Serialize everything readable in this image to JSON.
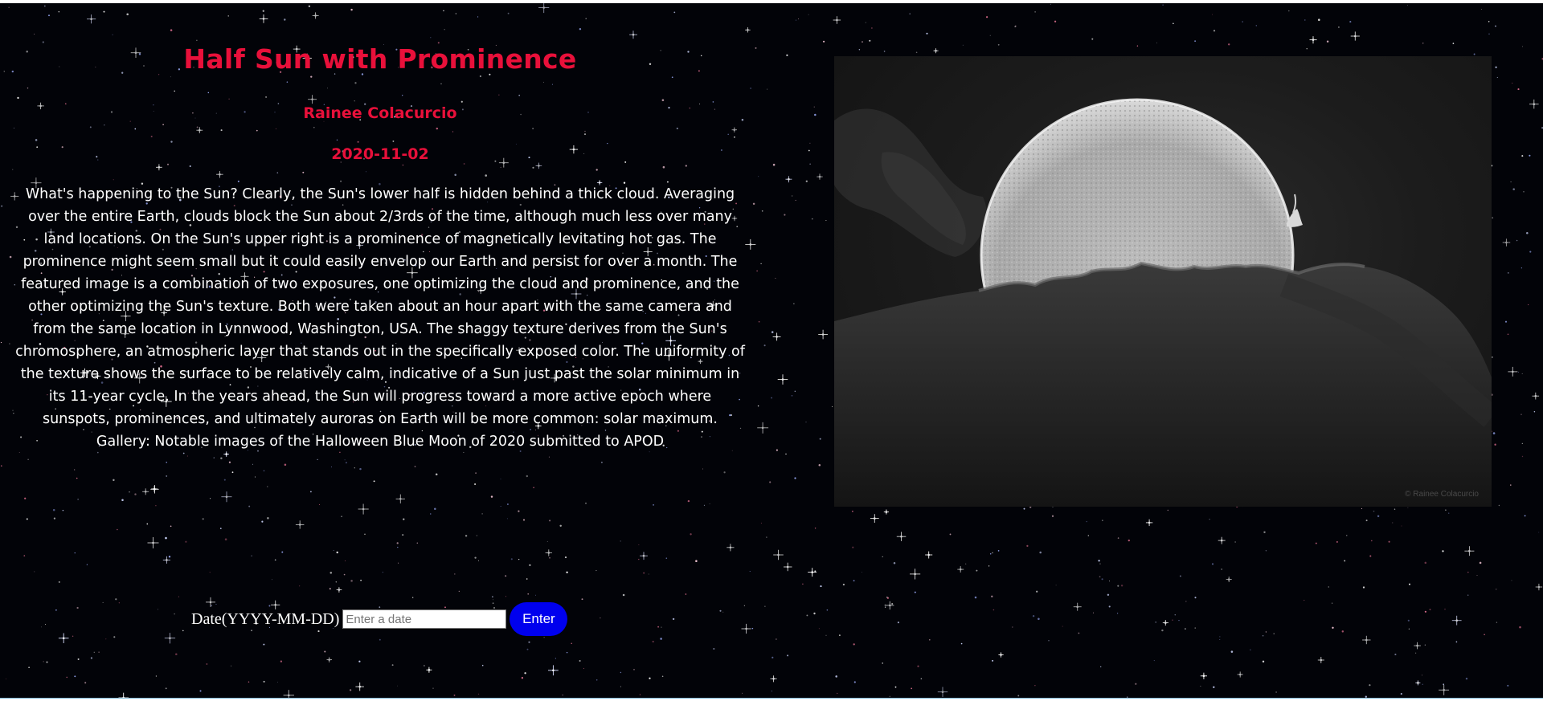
{
  "apod": {
    "title": "Half Sun with Prominence",
    "copyright": "Rainee Colacurcio",
    "date": "2020-11-02",
    "explanation": "What's happening to the Sun? Clearly, the Sun's lower half is hidden behind a thick cloud. Averaging over the entire Earth, clouds block the Sun about 2/3rds of the time, although much less over many land locations. On the Sun's upper right is a prominence of magnetically levitating hot gas. The prominence might seem small but it could easily envelop our Earth and persist for over a month. The featured image is a combination of two exposures, one optimizing the cloud and prominence, and the other optimizing the Sun's texture. Both were taken about an hour apart with the same camera and from the same location in Lynnwood, Washington, USA. The shaggy texture derives from the Sun's chromosphere, an atmospheric layer that stands out in the specifically exposed color. The uniformity of the texture shows the surface to be relatively calm, indicative of a Sun just past the solar minimum in its 11-year cycle. In the years ahead, the Sun will progress toward a more active epoch where sunspots, prominences, and ultimately auroras on Earth will be more common: solar maximum. Gallery: Notable images of the Halloween Blue Moon of 2020 submitted to APOD",
    "image_credit": "© Rainee Colacurcio"
  },
  "form": {
    "label": "Date(YYYY-MM-DD)",
    "input_value": "",
    "input_placeholder": "Enter a date",
    "button_label": "Enter"
  },
  "colors": {
    "accent_red": "#e8103a",
    "button_blue": "#0000ee",
    "background": "#020308"
  },
  "icons": {
    "background": "starfield-background",
    "photo": "half-sun-photo"
  }
}
